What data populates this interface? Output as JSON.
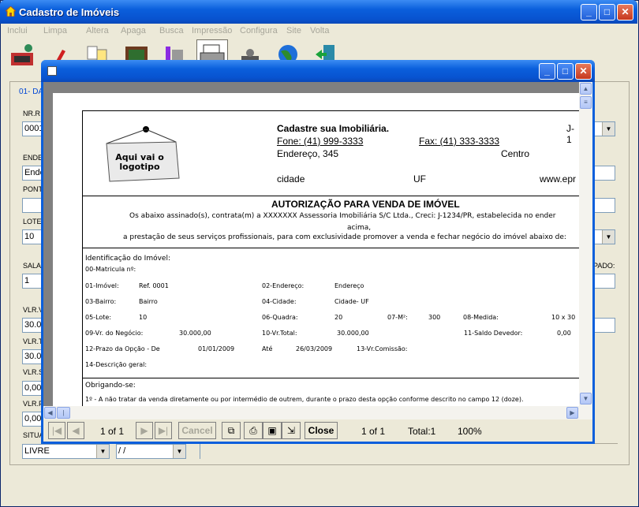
{
  "window": {
    "title": "Cadastro de Imóveis",
    "minimize": "_",
    "maximize": "□",
    "close": "✕"
  },
  "menu": [
    "Inclui",
    "Limpa",
    "Altera",
    "Apaga",
    "Busca",
    "Impressão",
    "Configura",
    "Site",
    "Volta"
  ],
  "toolbar_icons": [
    "new-record-icon",
    "pen-icon",
    "copy-icon",
    "photo-icon",
    "paint-icon",
    "print-icon",
    "settings-icon",
    "globe-icon",
    "exit-icon"
  ],
  "form": {
    "tab": "01- DA",
    "nr_label": "NR.R",
    "nr_value": "0001",
    "ende_label": "ENDE",
    "ende_value": "Ende",
    "pont_label": "PONT",
    "lote_label": "LOTE",
    "lote_value": "10",
    "sala_label": "SALA",
    "sala_value": "1",
    "vlrv_label": "VLR.V",
    "vlrv_value": "30.0",
    "vlrt_label": "VLR.T",
    "vlrt_value": "30.0",
    "vlrs_label": "VLR.S",
    "vlrs_value": "0,00",
    "vlrf_label": "VLR.F",
    "vlrf_value": "0,00",
    "situ_label": "SITUA",
    "situ_value": "LIVRE",
    "date_value": " / /",
    "pado_label": "PADO:"
  },
  "preview": {
    "nav": {
      "page": "1 of 1",
      "cancel": "Cancel",
      "close": "Close",
      "page2": "1 of 1",
      "total": "Total:1",
      "zoom": "100%"
    }
  },
  "doc": {
    "logo_text": "Aqui vai o logotipo",
    "company": "Cadastre sua Imobiliária.",
    "company_code": "J-1",
    "fone": "Fone: (41) 999-3333",
    "fax": "Fax: (41) 333-3333",
    "endereco": "Endereço, 345",
    "bairro": "Centro",
    "cidade": "cidade",
    "uf": "UF",
    "www": "www.epr",
    "heading": "AUTORIZAÇÃO PARA VENDA DE IMÓVEL",
    "intro1": "Os abaixo assinado(s), contrata(m) a XXXXXXX  Assessoria Imobiliária S/C Ltda., Creci: J-1234/PR, estabelecida no ender",
    "intro2": "acima,",
    "intro3": "a prestação de seus serviços profissionais, para com exclusividade promover a venda e fechar negócio do imóvel abaixo de:",
    "ident": "Identificação do Imóvel:",
    "matricula": "00-Matricula nº:",
    "r1": [
      "01-Imóvel:",
      "Ref. 0001",
      "02-Endereço:",
      "Endereço"
    ],
    "r2": [
      "03-Bairro:",
      "Bairro",
      "04-Cidade:",
      "Cidade- UF"
    ],
    "r3": [
      "05-Lote:",
      "10",
      "06-Quadra:",
      "20",
      "07-M²:",
      "300",
      "08-Medida:",
      "10 x 30"
    ],
    "r4": [
      "09-Vr. do Negócio:",
      "30.000,00",
      "10-Vr.Total:",
      "30.000,00",
      "11-Saldo Devedor:",
      "0,00"
    ],
    "r5": [
      "12-Prazo da Opção - De",
      "01/01/2009",
      "Até",
      "26/03/2009",
      "13-Vr.Comissão:"
    ],
    "r6": "14-Descrição geral:",
    "obrig": "Obrigando-se:",
    "clause1": "1º - A não tratar da venda diretamente ou por intermédio de outrem, durante o prazo desta opção conforme descrito no campo 12 (doze)."
  }
}
